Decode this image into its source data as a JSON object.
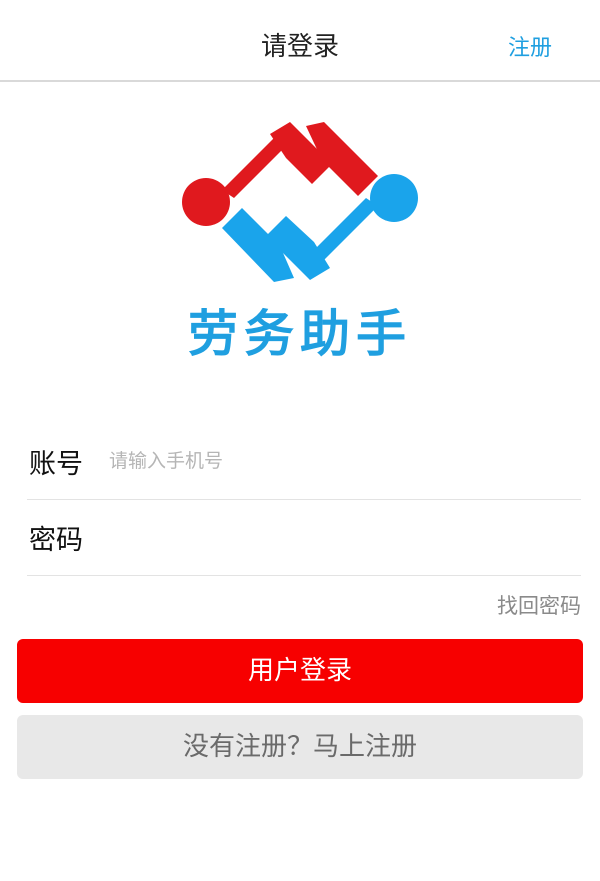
{
  "header": {
    "title": "请登录",
    "register_link": "注册"
  },
  "logo": {
    "icon": "handshake-logo-icon",
    "brand_name": "劳务助手",
    "colors": {
      "red": "#e0191e",
      "blue": "#1aa4eb"
    }
  },
  "form": {
    "account": {
      "label": "账号",
      "placeholder": "请输入手机号",
      "value": ""
    },
    "password": {
      "label": "密码",
      "placeholder": "",
      "value": ""
    },
    "forgot_password": "找回密码"
  },
  "actions": {
    "login_label": "用户登录",
    "register_label": "没有注册？马上注册"
  },
  "colors": {
    "accent_blue": "#1f9fe0",
    "login_button": "#f70000",
    "secondary_button": "#e8e8e8"
  }
}
